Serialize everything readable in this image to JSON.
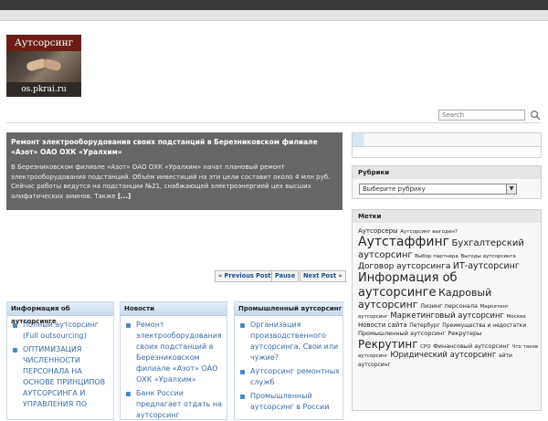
{
  "logo": {
    "title": "Аутсорсинг",
    "url": "os.pkrai.ru"
  },
  "search": {
    "placeholder": "Search"
  },
  "feature": {
    "title": "Ремонт электрооборудования своих подстанций в Березниковском филиале «Азот» ОАО ОХК «Уралхим»",
    "body": "В Березниковском филиале «Азот» ОАО ОХК «Уралхим» начат плановый ремонт электрооборудования подстанций. Объём инвестиций на эти цели составит около 4 млн руб. Сейчас работы ведутся на подстанции №21, снабжающей электроэнергией цех высших алифатических аминов. Также",
    "more": "[...]"
  },
  "pager": {
    "prev": "« Previous Post",
    "pause": "Pause",
    "next": "Next Post »"
  },
  "widgets": [
    {
      "title": "Информация об аутсорсинге",
      "items": [
        "Полный аутсорсинг (Full outsourcing)",
        "ОПТИМИЗАЦИЯ ЧИСЛЕННОСТИ ПЕРСОНАЛА НА ОСНОВЕ ПРИНЦИПОВ АУТСОРСИНГА И УПРАВЛЕНИЯ ПО"
      ]
    },
    {
      "title": "Новости",
      "items": [
        "Ремонт электрооборудования своих подстанций в Березниковском филиале «Азот» ОАО ОХК «Уралхим»",
        "Банк России предлагает отдать на аутсорсинг"
      ]
    },
    {
      "title": "Промышленный аутсорсинг",
      "items": [
        "Организация производственного аутсорсинга. Свои или чужие?",
        "Аутсорсинг ремонтных служб",
        "Промышленный аутсорсинг в России"
      ]
    }
  ],
  "sidebar": {
    "categories_title": "Рубрики",
    "categories_select": "Выберите рубрику",
    "tags_title": "Метки",
    "tags": [
      {
        "text": "Аутсорсеры",
        "size": 7
      },
      {
        "text": "Аутсорсинг выгоден?",
        "size": 5.5
      },
      {
        "text": "Аутстаффинг",
        "size": 14
      },
      {
        "text": "Бухгалтерский аутсорсинг",
        "size": 10
      },
      {
        "text": "Выбор партнера",
        "size": 5.5
      },
      {
        "text": "Выгоды аутсорсинга",
        "size": 5.5
      },
      {
        "text": "Договор аутсорсинга",
        "size": 9
      },
      {
        "text": "ИТ-аутсорсинг",
        "size": 9.5
      },
      {
        "text": "Информация об аутсорсинге",
        "size": 13
      },
      {
        "text": "Кадровый аутсорсинг",
        "size": 11
      },
      {
        "text": "Лизинг персонала",
        "size": 6.5
      },
      {
        "text": "Маркетинг аутсорсинг",
        "size": 5.5
      },
      {
        "text": "Маркетинговый аутсорсинг",
        "size": 8.5
      },
      {
        "text": "Москва",
        "size": 5.5
      },
      {
        "text": "Новости сайта",
        "size": 7
      },
      {
        "text": "Петербург",
        "size": 6
      },
      {
        "text": "Преимущества и недостатки",
        "size": 6
      },
      {
        "text": "Промышленный аутсорсинг",
        "size": 6.5
      },
      {
        "text": "Рекрутеры",
        "size": 6.5
      },
      {
        "text": "Рекрутинг",
        "size": 12
      },
      {
        "text": "СРО",
        "size": 5.5
      },
      {
        "text": "Финансовый аутсорсинг",
        "size": 6.5
      },
      {
        "text": "Что такое аутсорсинг",
        "size": 5.5
      },
      {
        "text": "Юридический аутсорсинг",
        "size": 8.5
      },
      {
        "text": "айти аутсорсинг",
        "size": 6
      }
    ]
  }
}
